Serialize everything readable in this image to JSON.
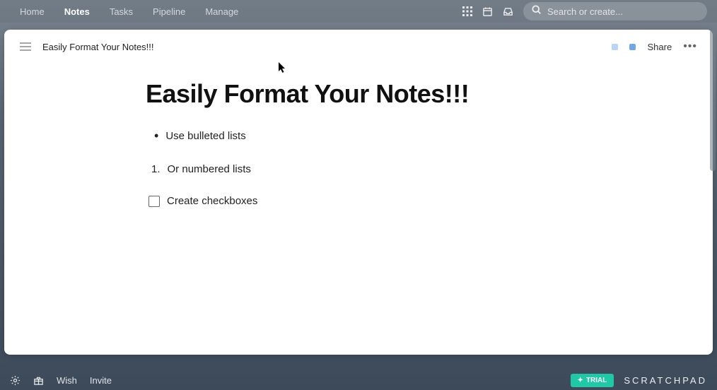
{
  "topnav": {
    "items": [
      "Home",
      "Notes",
      "Tasks",
      "Pipeline",
      "Manage"
    ],
    "active_index": 1
  },
  "search": {
    "placeholder": "Search or create..."
  },
  "note": {
    "title_small": "Easily Format Your Notes!!!",
    "title_big": "Easily Format Your Notes!!!",
    "share_label": "Share",
    "bullet_text": "Use bulleted lists",
    "numbered_prefix": "1.",
    "numbered_text": "Or numbered lists",
    "checkbox_text": "Create checkboxes",
    "tag_colors": [
      "#b9d6f5",
      "#6ea8e8"
    ]
  },
  "bottom": {
    "wish": "Wish",
    "invite": "Invite",
    "trial": "TRIAL",
    "brand": "SCRATCHPAD"
  }
}
